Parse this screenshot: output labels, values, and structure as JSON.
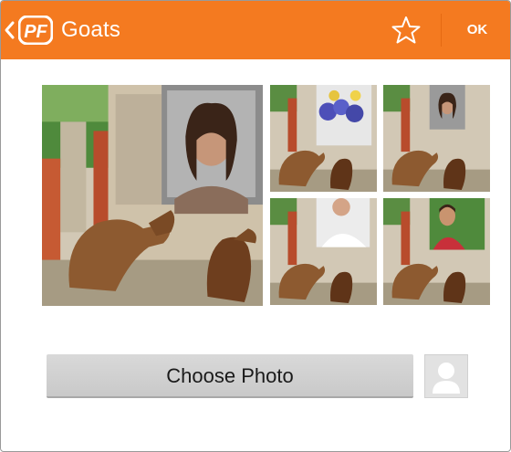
{
  "app_bar": {
    "title": "Goats",
    "logo_text": "PF",
    "ok_label": "OK",
    "accent_color": "#f47a20",
    "back_icon": "chevron-left-icon",
    "favorite_icon": "star-outline-icon"
  },
  "templates": [
    {
      "name": "large-preview",
      "face": "woman-portrait"
    },
    {
      "name": "flowers",
      "face": "blue-flowers"
    },
    {
      "name": "woman-small",
      "face": "woman-portrait"
    },
    {
      "name": "man-white-shirt",
      "face": "man-white-shirt"
    },
    {
      "name": "man-red-shirt",
      "face": "man-red-shirt"
    }
  ],
  "actions": {
    "choose_photo_label": "Choose Photo",
    "avatar_icon": "user-placeholder-icon"
  }
}
